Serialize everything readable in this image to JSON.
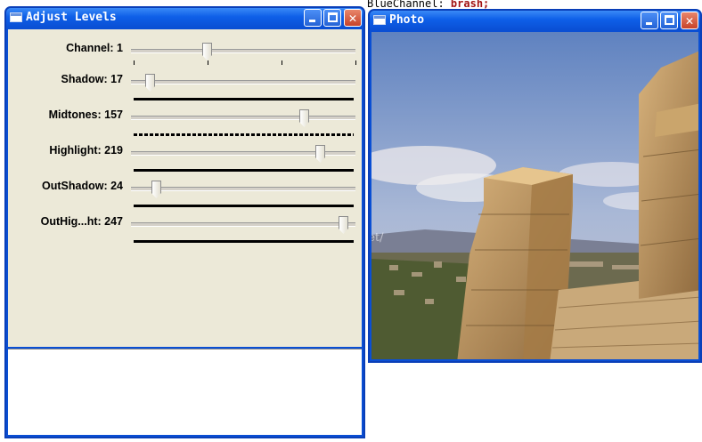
{
  "background": {
    "code_text_prefix": "BlueChannel: ",
    "code_text_keyword": "brash;"
  },
  "levels_window": {
    "title": "Adjust Levels",
    "sliders": [
      {
        "label": "Channel: 1",
        "value": 1,
        "max": 3,
        "bar": "ticks"
      },
      {
        "label": "Shadow: 17",
        "value": 17,
        "max": 255,
        "bar": "solid"
      },
      {
        "label": "Midtones: 157",
        "value": 157,
        "max": 200,
        "bar": "dashed"
      },
      {
        "label": "Highlight: 219",
        "value": 219,
        "max": 255,
        "bar": "solid"
      },
      {
        "label": "OutShadow: 24",
        "value": 24,
        "max": 255,
        "bar": "solid"
      },
      {
        "label": "OutHig...ht: 247",
        "value": 247,
        "max": 255,
        "bar": "solid"
      }
    ]
  },
  "photo_window": {
    "title": "Photo",
    "image_description_icon": "acropolis-photo",
    "watermark": "http://blog.csdn.net/"
  },
  "title_buttons": {
    "minimize": "minimize-icon",
    "maximize": "maximize-icon",
    "close": "close-icon"
  }
}
